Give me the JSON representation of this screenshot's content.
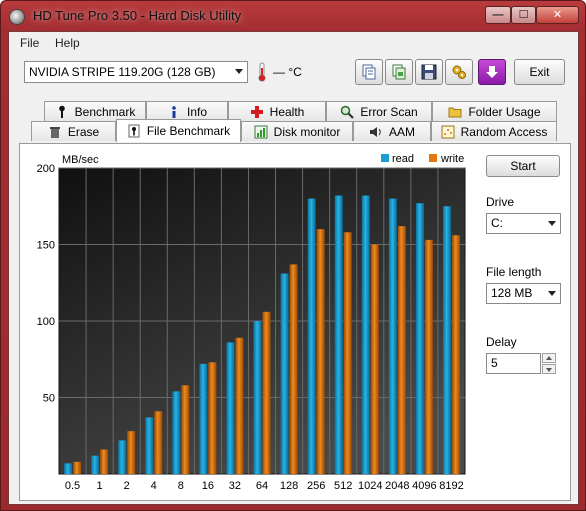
{
  "window": {
    "title": "HD Tune Pro 3.50 - Hard Disk Utility",
    "minimize_glyph": "—",
    "maximize_glyph": "☐",
    "close_glyph": "✕"
  },
  "menu": {
    "file": "File",
    "help": "Help"
  },
  "toolbar": {
    "drive": "NVIDIA  STRIPE   119.20G (128 GB)",
    "temperature": "— °C",
    "exit": "Exit",
    "icons": [
      "copy-text-icon",
      "copy-screenshot-icon",
      "save-icon",
      "options-icon",
      "download-icon"
    ]
  },
  "tabs": {
    "row1": [
      "Benchmark",
      "Info",
      "Health",
      "Error Scan",
      "Folder Usage"
    ],
    "row2": [
      "Erase",
      "File Benchmark",
      "Disk monitor",
      "AAM",
      "Random Access"
    ],
    "active": "File Benchmark"
  },
  "controls": {
    "start": "Start",
    "drive_label": "Drive",
    "drive_value": "C:",
    "file_length_label": "File length",
    "file_length_value": "128 MB",
    "delay_label": "Delay",
    "delay_value": "5"
  },
  "colors": {
    "read": "#1a9fd3",
    "write": "#e2780f"
  },
  "chart_data": {
    "type": "bar",
    "ylabel": "MB/sec",
    "ylim": [
      0,
      200
    ],
    "yticks": [
      50,
      100,
      150,
      200
    ],
    "categories": [
      "0.5",
      "1",
      "2",
      "4",
      "8",
      "16",
      "32",
      "64",
      "128",
      "256",
      "512",
      "1024",
      "2048",
      "4096",
      "8192"
    ],
    "series": [
      {
        "name": "read",
        "values": [
          7,
          12,
          22,
          37,
          54,
          72,
          86,
          100,
          131,
          180,
          182,
          182,
          180,
          177,
          175
        ]
      },
      {
        "name": "write",
        "values": [
          8,
          16,
          28,
          41,
          58,
          73,
          89,
          106,
          137,
          160,
          158,
          150,
          162,
          153,
          156
        ]
      }
    ],
    "grid": true,
    "legend": "top-right"
  }
}
